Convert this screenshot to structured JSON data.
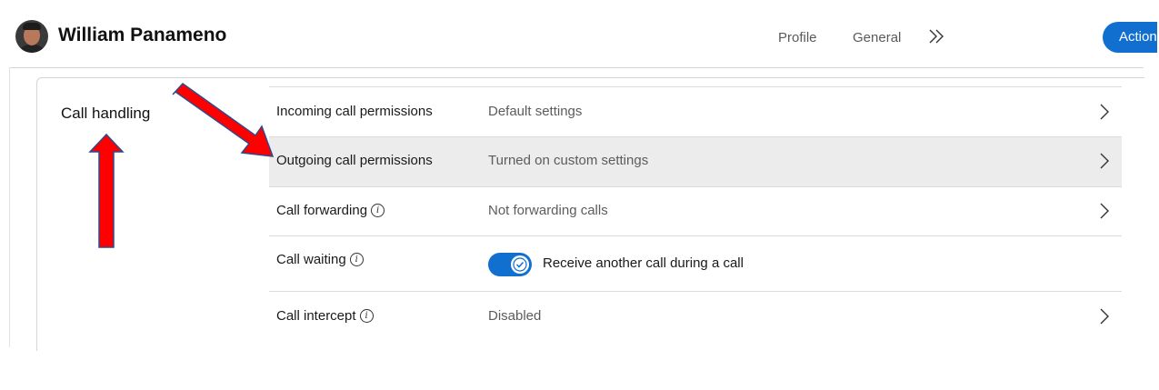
{
  "header": {
    "user_name": "William Panameno",
    "tabs": [
      {
        "label": "Profile"
      },
      {
        "label": "General"
      }
    ],
    "more_icon": "double-chevron-right-icon",
    "actions_label": "Actions"
  },
  "section": {
    "title": "Call handling",
    "rows": [
      {
        "label": "Incoming call permissions",
        "value": "Default settings",
        "info": false,
        "chevron": true
      },
      {
        "label": "Outgoing call permissions",
        "value": "Turned on custom settings",
        "info": false,
        "chevron": true,
        "highlighted": true
      },
      {
        "label": "Call forwarding",
        "value": "Not forwarding calls",
        "info": true,
        "chevron": true
      },
      {
        "label": "Call waiting",
        "toggle_on": true,
        "toggle_label": "Receive another call during a call",
        "info": true,
        "chevron": false
      },
      {
        "label": "Call intercept",
        "value": "Disabled",
        "info": true,
        "chevron": true
      }
    ]
  },
  "colors": {
    "accent": "#1170cf",
    "highlight_row": "#ececec",
    "annotation_arrow": "#ff0000",
    "annotation_outline": "#2e4a8a"
  }
}
